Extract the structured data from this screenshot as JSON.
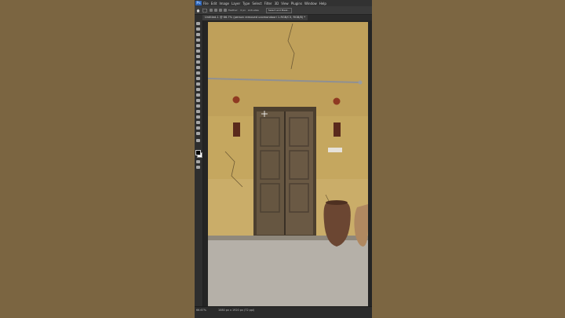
{
  "app": {
    "logo": "Ps"
  },
  "menu": [
    "File",
    "Edit",
    "Image",
    "Layer",
    "Type",
    "Select",
    "Filter",
    "3D",
    "View",
    "Plugins",
    "Window",
    "Help"
  ],
  "options": {
    "feather": "Feather:",
    "feather_value": "0 px",
    "antialias": "Anti-alias",
    "select_mask": "Select and Mask..."
  },
  "document": {
    "tab_title": "Untitled-1 @ 66.7% (person removed ucomondoori 1-RGB/C3, RGB/8) *"
  },
  "status": {
    "zoom": "66.67%",
    "info": "1080 px x 1920 px (72 ppi)"
  },
  "icons": {
    "home": "home-icon",
    "marquee": "marquee-icon",
    "crosshair": "crosshair-cursor-icon"
  },
  "colors": {
    "bg": "#7a6440",
    "ps_dark": "#2b2b2b",
    "wall": "#c7a860",
    "door": "#665641"
  }
}
